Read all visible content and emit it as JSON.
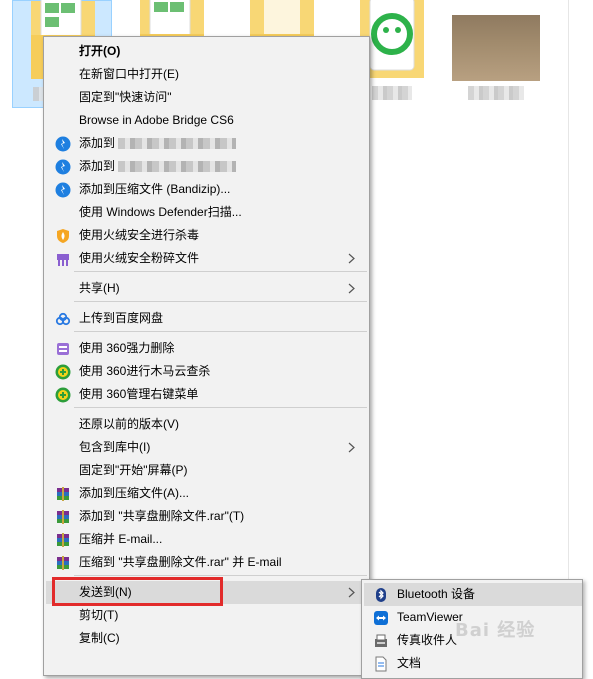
{
  "explorer": {
    "items": [
      {
        "type": "folder",
        "selected": true
      },
      {
        "type": "folder",
        "selected": false
      },
      {
        "type": "folder",
        "selected": false
      },
      {
        "type": "app-folder",
        "selected": false
      },
      {
        "type": "image",
        "selected": false
      }
    ]
  },
  "menu": {
    "items": [
      {
        "id": "open",
        "label": "打开(O)",
        "bold": true
      },
      {
        "id": "open-new-window",
        "label": "在新窗口中打开(E)"
      },
      {
        "id": "pin-quick-access",
        "label": "固定到\"快速访问\""
      },
      {
        "id": "browse-bridge",
        "label": "Browse in Adobe Bridge CS6"
      },
      {
        "id": "bandizip-add-1",
        "label": "添加到",
        "icon": "bandizip-icon"
      },
      {
        "id": "bandizip-add-2",
        "label": "添加到",
        "icon": "bandizip-icon"
      },
      {
        "id": "bandizip-compress",
        "label": "添加到压缩文件 (Bandizip)...",
        "icon": "bandizip-icon"
      },
      {
        "id": "defender-scan",
        "label": "使用 Windows Defender扫描..."
      },
      {
        "id": "huorong-scan",
        "label": "使用火绒安全进行杀毒",
        "icon": "huorong-shield-icon"
      },
      {
        "id": "huorong-shred",
        "label": "使用火绒安全粉碎文件",
        "icon": "shredder-icon",
        "submenu": true
      },
      {
        "id": "share",
        "label": "共享(H)",
        "submenu": true
      },
      {
        "id": "baidu-upload",
        "label": "上传到百度网盘",
        "icon": "baidu-cloud-icon"
      },
      {
        "id": "360-force-delete",
        "label": "使用 360强力删除",
        "icon": "360-delete-icon"
      },
      {
        "id": "360-trojan-scan",
        "label": "使用 360进行木马云查杀",
        "icon": "360-shield-icon"
      },
      {
        "id": "360-context-manager",
        "label": "使用 360管理右键菜单",
        "icon": "360-shield-icon"
      },
      {
        "id": "restore-versions",
        "label": "还原以前的版本(V)"
      },
      {
        "id": "include-library",
        "label": "包含到库中(I)",
        "submenu": true
      },
      {
        "id": "pin-start",
        "label": "固定到\"开始\"屏幕(P)"
      },
      {
        "id": "winrar-add",
        "label": "添加到压缩文件(A)...",
        "icon": "winrar-icon"
      },
      {
        "id": "winrar-add-named",
        "label": "添加到 \"共享盘删除文件.rar\"(T)",
        "icon": "winrar-icon"
      },
      {
        "id": "winrar-email",
        "label": "压缩并 E-mail...",
        "icon": "winrar-icon"
      },
      {
        "id": "winrar-email-named",
        "label": "压缩到 \"共享盘删除文件.rar\" 并 E-mail",
        "icon": "winrar-icon"
      },
      {
        "id": "send-to",
        "label": "发送到(N)",
        "submenu": true,
        "highlighted": true
      },
      {
        "id": "cut",
        "label": "剪切(T)"
      },
      {
        "id": "copy",
        "label": "复制(C)"
      }
    ]
  },
  "submenu": {
    "items": [
      {
        "id": "bluetooth",
        "label": "Bluetooth 设备",
        "icon": "bluetooth-icon",
        "highlighted": true
      },
      {
        "id": "teamviewer",
        "label": "TeamViewer",
        "icon": "teamviewer-icon"
      },
      {
        "id": "fax",
        "label": "传真收件人",
        "icon": "fax-icon"
      },
      {
        "id": "documents",
        "label": "文档",
        "icon": "document-icon"
      }
    ]
  },
  "watermark": {
    "text": "Bai 经验"
  },
  "colors": {
    "menu_bg": "#f2f2f2",
    "highlight": "#dadada",
    "annotation_red": "#e22b2b",
    "selection": "#cce8ff",
    "folder": "#f8d775"
  }
}
